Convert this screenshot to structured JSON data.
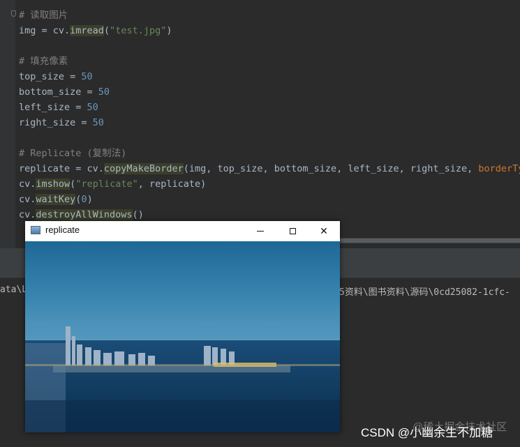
{
  "editor": {
    "lines": [
      [
        {
          "t": "# 读取图片",
          "c": "cm"
        }
      ],
      [
        {
          "t": "img = cv.",
          "c": ""
        },
        {
          "t": "imread",
          "c": "fn"
        },
        {
          "t": "(",
          "c": ""
        },
        {
          "t": "\"test.jpg\"",
          "c": "str"
        },
        {
          "t": ")",
          "c": ""
        }
      ],
      [],
      [
        {
          "t": "# 填充像素",
          "c": "cm"
        }
      ],
      [
        {
          "t": "top_size = ",
          "c": ""
        },
        {
          "t": "50",
          "c": "num"
        }
      ],
      [
        {
          "t": "bottom_size = ",
          "c": ""
        },
        {
          "t": "50",
          "c": "num"
        }
      ],
      [
        {
          "t": "left_size = ",
          "c": ""
        },
        {
          "t": "50",
          "c": "num"
        }
      ],
      [
        {
          "t": "right_size = ",
          "c": ""
        },
        {
          "t": "50",
          "c": "num"
        }
      ],
      [],
      [
        {
          "t": "# Replicate (复制法)",
          "c": "cm"
        }
      ],
      [
        {
          "t": "replicate = cv.",
          "c": ""
        },
        {
          "t": "copyMakeBorder",
          "c": "fn"
        },
        {
          "t": "(img, top_size, bottom_size, left_size, right_size, ",
          "c": ""
        },
        {
          "t": "borderTyp",
          "c": "kw"
        }
      ],
      [
        {
          "t": "cv.",
          "c": ""
        },
        {
          "t": "imshow",
          "c": "fn"
        },
        {
          "t": "(",
          "c": ""
        },
        {
          "t": "\"replicate\"",
          "c": "str"
        },
        {
          "t": ", replicate)",
          "c": ""
        }
      ],
      [
        {
          "t": "cv.",
          "c": ""
        },
        {
          "t": "waitKey",
          "c": "fn"
        },
        {
          "t": "(",
          "c": ""
        },
        {
          "t": "0",
          "c": "num"
        },
        {
          "t": ")",
          "c": ""
        }
      ],
      [
        {
          "t": "cv.",
          "c": ""
        },
        {
          "t": "destroyAllWindows",
          "c": "fn"
        },
        {
          "t": "()",
          "c": ""
        }
      ]
    ]
  },
  "console": {
    "left_text": "ata\\L",
    "right_text": "5资料\\图书资料\\源码\\0cd25082-1cfc-"
  },
  "window": {
    "title": "replicate",
    "close_glyph": "✕"
  },
  "watermark": {
    "faint": "@稀土掘金技术社区",
    "main": "CSDN @小幽余生不加糖"
  },
  "colors": {
    "sky_top": "#1f6c9a",
    "sky_bottom": "#3e8ab4",
    "sea": "#0f3d63"
  }
}
